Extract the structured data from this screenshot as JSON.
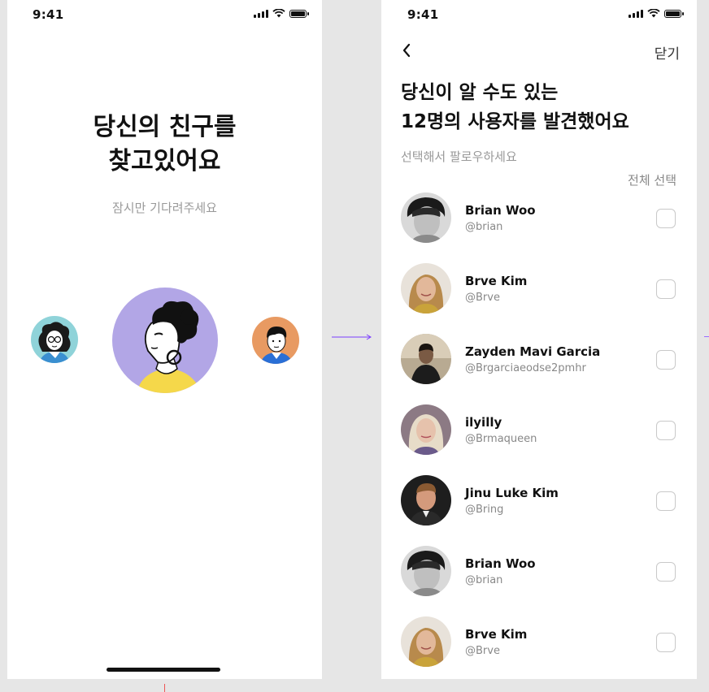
{
  "status_bar": {
    "time": "9:41"
  },
  "find_screen": {
    "title_line1": "당신의 친구를",
    "title_line2": "찾고있어요",
    "subtitle": "잠시만 기다려주세요"
  },
  "results_screen": {
    "close_label": "닫기",
    "title_line1": "당신이 알 수도 있는",
    "title_line2": "12명의 사용자를 발견했어요",
    "subtitle": "선택해서 팔로우하세요",
    "select_all_label": "전체 선택",
    "users": [
      {
        "name": "Brian Woo",
        "handle": "@brian",
        "avatar": "bw"
      },
      {
        "name": "Brve Kim",
        "handle": "@Brve",
        "avatar": "blonde"
      },
      {
        "name": "Zayden Mavi Garcia",
        "handle": "@Brgarciaeodse2pmhr",
        "avatar": "dark"
      },
      {
        "name": "ilyilly",
        "handle": "@Brmaqueen",
        "avatar": "platinum"
      },
      {
        "name": "Jinu Luke Kim",
        "handle": "@Bring",
        "avatar": "suit"
      },
      {
        "name": "Brian Woo",
        "handle": "@brian",
        "avatar": "bw"
      },
      {
        "name": "Brve Kim",
        "handle": "@Brve",
        "avatar": "blonde"
      }
    ]
  },
  "colors": {
    "accent_arrow": "#7b3dff",
    "avatar_main_bg": "#b2a6e6",
    "avatar_left_bg": "#8fd3d9",
    "avatar_right_bg": "#e89a62"
  }
}
